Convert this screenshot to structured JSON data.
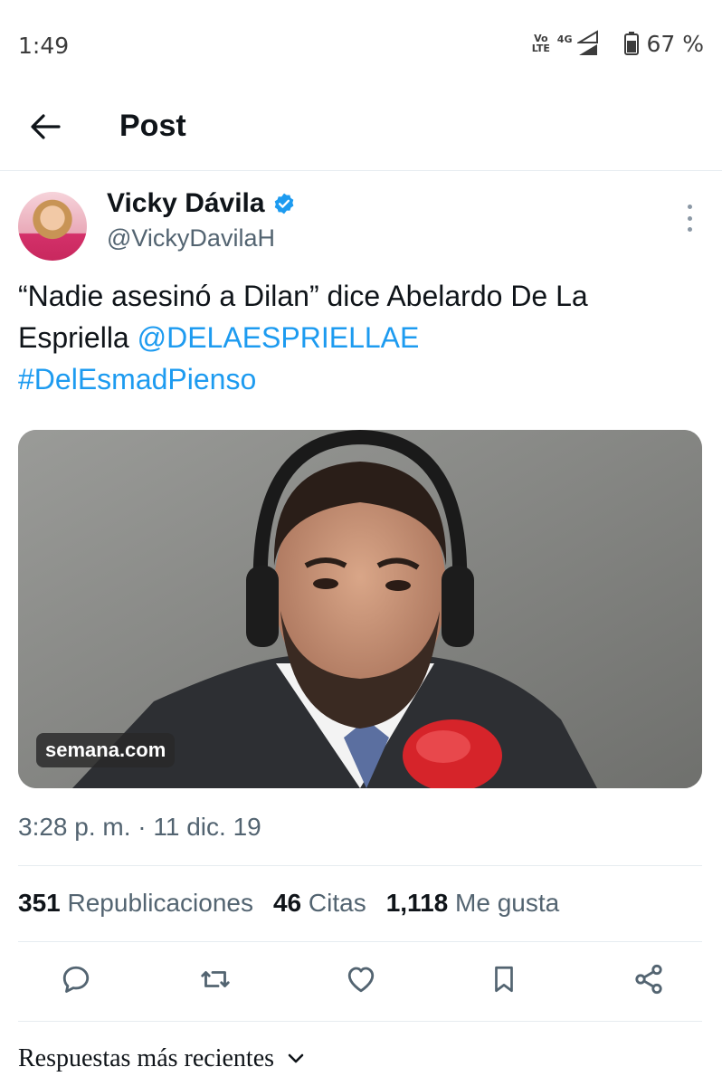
{
  "status_bar": {
    "time": "1:49",
    "volte_label": "Vo LTE",
    "network_type": "4G",
    "battery_percent": "67 %"
  },
  "header": {
    "title": "Post",
    "back_icon": "arrow-left-icon"
  },
  "post": {
    "author": {
      "name": "Vicky Dávila",
      "handle": "@VickyDavilaH",
      "verified": true,
      "verified_color": "#1d9bf0"
    },
    "text_parts": {
      "quote": "“Nadie asesinó a Dilan” dice Abelardo De La Espriella ",
      "mention": "@DELAESPRIELLAE",
      "hashtag": "#DelEsmadPienso"
    },
    "media": {
      "source_label": "semana.com"
    },
    "timestamp": "3:28 p. m. · 11 dic. 19",
    "stats": {
      "reposts_count": "351",
      "reposts_label": "Republicaciones",
      "quotes_count": "46",
      "quotes_label": "Citas",
      "likes_count": "1,118",
      "likes_label": "Me gusta"
    },
    "actions": [
      "reply-icon",
      "repost-icon",
      "like-icon",
      "bookmark-icon",
      "share-icon"
    ]
  },
  "replies": {
    "sort_label": "Respuestas más recientes"
  },
  "colors": {
    "link": "#1d9bf0",
    "text_primary": "#0f1419",
    "text_secondary": "#536471"
  }
}
